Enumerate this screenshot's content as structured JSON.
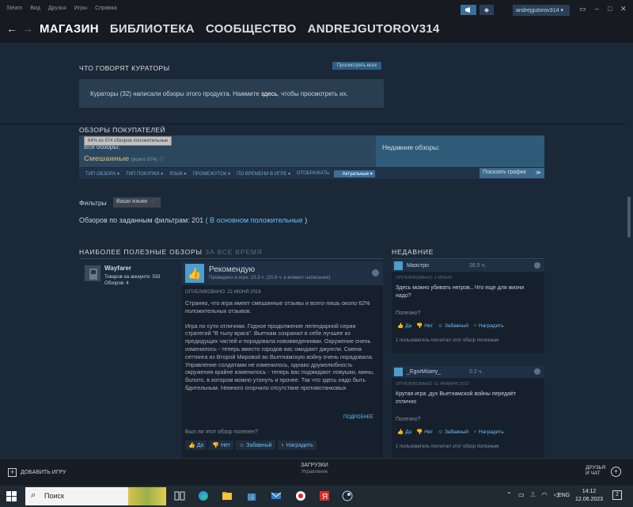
{
  "menubar": {
    "items": [
      "Steam",
      "Вид",
      "Друзья",
      "Игры",
      "Справка"
    ],
    "username": "andrejgutorov314",
    "bell_icon": "◆"
  },
  "nav": {
    "back": "←",
    "forward": "→",
    "links": [
      "МАГАЗИН",
      "БИБЛИОТЕКА",
      "СООБЩЕСТВО",
      "ANDREJGUTOROV314"
    ]
  },
  "curators": {
    "title": "ЧТО ГОВОРЯТ КУРАТОРЫ",
    "see_all": "Просмотреть всех",
    "text_before": "Кураторы (32) написали обзоры этого продукта. Нажмите ",
    "here": "здесь",
    "text_after": ", чтобы просмотреть их."
  },
  "reviews_summary": {
    "title": "ОБЗОРЫ ПОКУПАТЕЛЕЙ",
    "tooltip": "64% из 874 обзоров положительные",
    "all_label": "Все обзоры:",
    "rating": "Смешанные",
    "count": "(всего 874)",
    "recent_label": "Недавние обзоры:",
    "colors": {
      "mixed": "#b9a074",
      "accent": "#66c0f4"
    }
  },
  "filterbar": {
    "items": [
      "ТИП ОБЗОРА ▾",
      "ТИП ПОКУПКИ ▾",
      "ЯЗЫК ▾",
      "ПРОМЕЖУТОК ▾",
      "ПО ВРЕМЕНИ В ИГРЕ ▾",
      "ОТОБРАЖАТЬ:"
    ],
    "display_value": "Актуальные",
    "show_graph": "Показать график"
  },
  "filters": {
    "label": "Фильтры",
    "lang_button": "Ваши языки",
    "count_text": "Обзоров по заданным фильтрам: 201",
    "count_rating": "( В основном положительные",
    "count_close": ")"
  },
  "helpful": {
    "title": "НАИБОЛЕЕ ПОЛЕЗНЫЕ ОБЗОРЫ",
    "subtitle": "ЗА ВСЕ ВРЕМЯ",
    "recent_title": "НЕДАВНИЕ"
  },
  "main_review": {
    "author": "Wayfarer",
    "products": "Товаров на аккаунте: 533",
    "reviews": "Обзоров: 4",
    "verdict": "Рекомендую",
    "played": "Проведено в игре: 23.3 ч. (20.9 ч. в момент написания)",
    "posted": "ОПУБЛИКОВАНО: 22 ИЮНЯ 2018",
    "paragraph1": "Странно, что игра имеет смешанные отзывы и всего-лишь около 62% положительных отзывов.",
    "paragraph2": "Игра по сути отличная. Годное продолжение легендарной серии стратегий \"В тылу врага\". Вьетнам сохранил в себе лучшее из предидущих частей и порадовала нововведениями. Окружение очень изменилось - теперь вместо городов вас ожидают джунгли. Смена сеттинга из Второй Мировой во Вьетнамскую войну очень порадовала. Управление солдатами не изменилось, однако дружелюбность окружения крайне изменилось - теперь вас поджидают ловушки, мины, болото, в котором можно утонуть и прочее. Так что здесь надо быть бдительным. Немного огорчило отсутствие противотанковых",
    "more": "ПОДРОБНЕЕ",
    "helpful_q": "Был ли этот обзор полезен?",
    "yes": "Да",
    "no": "Нет",
    "funny": "Забавный",
    "award": "Наградить"
  },
  "recent_reviews": [
    {
      "name": "Маэстро",
      "hours": "26.5 ч.",
      "date": "ОПУБЛИКОВАНО: 2 ИЮНЯ",
      "text": "Здесь можно убивать негров...Что еще для жизни надо?",
      "helpful_q": "Полезно?",
      "yes": "Да",
      "no": "Нет",
      "funny": "Забавный",
      "award": "Наградить",
      "found": "1 пользователь посчитал этот обзор полезным"
    },
    {
      "name": "_EgorMisery_",
      "hours": "0.2 ч.",
      "date": "ОПУБЛИКОВАНО: 11 ЯНВАРЯ 2022",
      "text": "Крутая игра ,дух Вьетнамской войны передаёт отлично",
      "helpful_q": "Полезно?",
      "yes": "Да",
      "no": "Нет",
      "funny": "Забавный",
      "award": "Наградить",
      "found": "1 пользователь посчитал этот обзор полезным"
    }
  ],
  "bottombar": {
    "add_game": "ДОБАВИТЬ ИГРУ",
    "downloads": "ЗАГРУЗКИ",
    "downloads_sub": "Управление",
    "friends_line1": "ДРУЗЬЯ",
    "friends_line2": "И ЧАТ"
  },
  "taskbar": {
    "search_placeholder": "Поиск",
    "lang": "ENG",
    "time": "14:12",
    "date": "12.06.2023",
    "notif_count": "2"
  }
}
